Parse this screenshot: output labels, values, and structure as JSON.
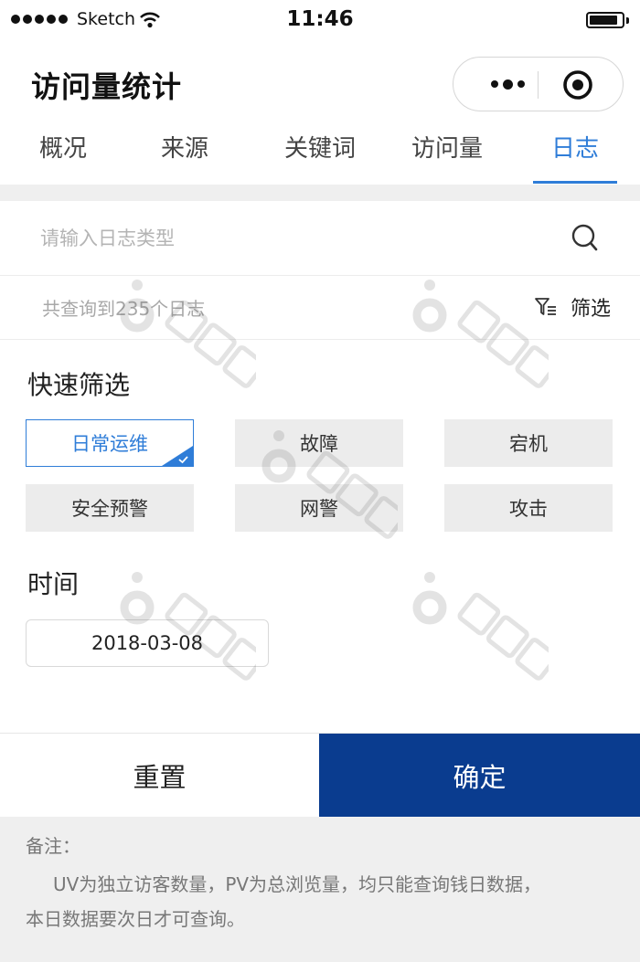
{
  "status_bar": {
    "carrier": "Sketch",
    "time": "11:46"
  },
  "nav": {
    "title": "访问量统计",
    "more_icon": "ellipsis-icon",
    "close_icon": "target-close-icon"
  },
  "tabs": [
    {
      "label": "概况",
      "active": false
    },
    {
      "label": "来源",
      "active": false
    },
    {
      "label": "关键词",
      "active": false
    },
    {
      "label": "访问量",
      "active": false
    },
    {
      "label": "日志",
      "active": true
    }
  ],
  "search": {
    "placeholder": "请输入日志类型",
    "value": ""
  },
  "results": {
    "count_text": "共查询到235个日志",
    "filter_label": "筛选"
  },
  "quick_filter": {
    "title": "快速筛选",
    "options": [
      {
        "label": "日常运维",
        "selected": true
      },
      {
        "label": "故障",
        "selected": false
      },
      {
        "label": "宕机",
        "selected": false
      },
      {
        "label": "安全预警",
        "selected": false
      },
      {
        "label": "网警",
        "selected": false
      },
      {
        "label": "攻击",
        "selected": false
      }
    ]
  },
  "time_filter": {
    "title": "时间",
    "date": "2018-03-08"
  },
  "actions": {
    "reset": "重置",
    "confirm": "确定"
  },
  "notes": {
    "title": "备注：",
    "line1": "UV为独立访客数量，PV为总浏览量，均只能查询钱日数据，",
    "line2": "本日数据要次日才可查询。"
  },
  "colors": {
    "accent": "#2f7dd8",
    "primary_button": "#0a3c8f",
    "chip_bg": "#ececec",
    "notes_bg": "#efefef"
  }
}
